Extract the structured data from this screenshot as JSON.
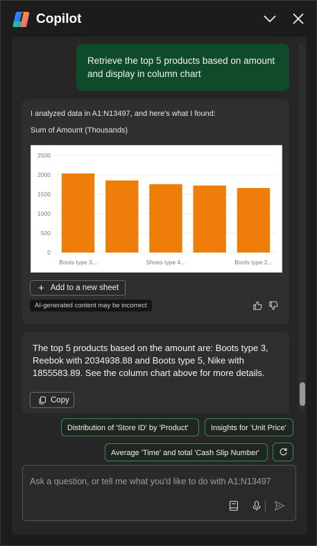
{
  "app": {
    "title": "Copilot",
    "icons": {
      "logo": "copilot-logo",
      "minimize": "chevron-down-icon",
      "close": "close-icon"
    }
  },
  "conversation": {
    "user_message": "Retrieve the top 5 products based on amount and display in column chart",
    "response_card": {
      "intro": "I analyzed data in A1:N13497, and here's what I found:",
      "chart_subtitle": "Sum of Amount (Thousands)",
      "add_button_label": "Add to a new sheet",
      "disclaimer": "AI-generated content may be incorrect",
      "feedback_icons": [
        "thumbs-up-icon",
        "thumbs-down-icon"
      ]
    },
    "answer_card": {
      "text": "The top 5 products based on the amount are: Boots type 3, Reebok with 2034938.88 and Boots type 5, Nike with 1855583.89. See the column chart above for more details.",
      "copy_label": "Copy"
    }
  },
  "chart_data": {
    "type": "bar",
    "title": "Sum of Amount (Thousands)",
    "categories": [
      "Boots type 3...",
      "",
      "Shoes type 4...",
      "",
      "Boots type 2..."
    ],
    "values": [
      2035,
      1856,
      1760,
      1725,
      1660
    ],
    "ylim": [
      0,
      2500
    ],
    "yticks": [
      "0",
      "500",
      "1000",
      "1500",
      "2000",
      "2500"
    ],
    "ytick_values": [
      0,
      500,
      1000,
      1500,
      2000,
      2500
    ],
    "bar_color": "#ef7d0a",
    "grid": true,
    "legend": "none"
  },
  "suggestions": [
    "Distribution of 'Store ID' by 'Product'",
    "Insights for 'Unit Price'",
    "Average 'Time' and total 'Cash Slip Number'"
  ],
  "input": {
    "placeholder": "Ask a question, or tell me what you'd like to do with A1:N13497",
    "value": "",
    "icons": [
      "notebook-icon",
      "microphone-icon",
      "send-icon"
    ]
  },
  "colors": {
    "background": "#1c1c1c",
    "panel": "#262626",
    "card": "#2f2f2f",
    "user_bubble": "#0f4a2a",
    "chip_border": "#2f8f5a",
    "bar": "#ef7d0a"
  }
}
